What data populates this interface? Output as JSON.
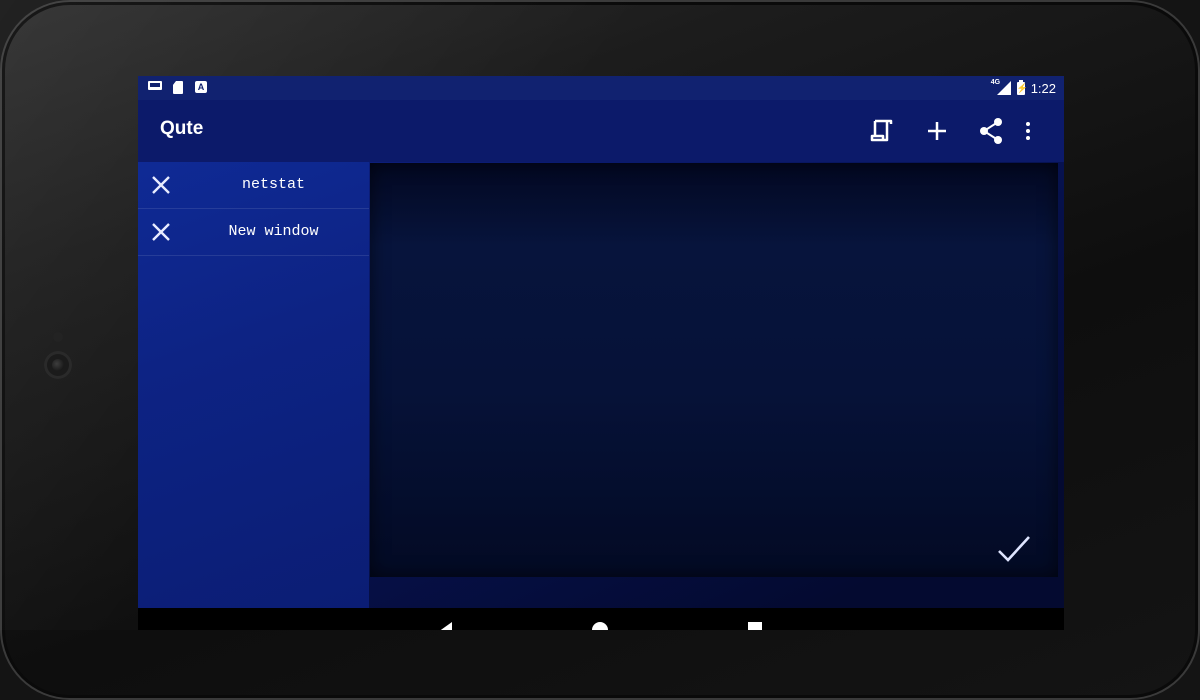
{
  "status_bar": {
    "left_icons": [
      "laptop-icon",
      "sd-card-icon",
      "font-a-icon"
    ],
    "network": "4G",
    "time": "1:22",
    "badge_letter": "A"
  },
  "app_bar": {
    "title": "Qute",
    "actions": [
      "scroll-icon",
      "plus-icon",
      "share-icon",
      "more-vert-icon"
    ]
  },
  "tabs": [
    {
      "label": "netstat"
    },
    {
      "label": "New window"
    }
  ],
  "colors": {
    "status_bar": "#112270",
    "app_bar": "#0c1a6a",
    "sidebar": "#0d2384",
    "terminal_bg": "#061238"
  }
}
